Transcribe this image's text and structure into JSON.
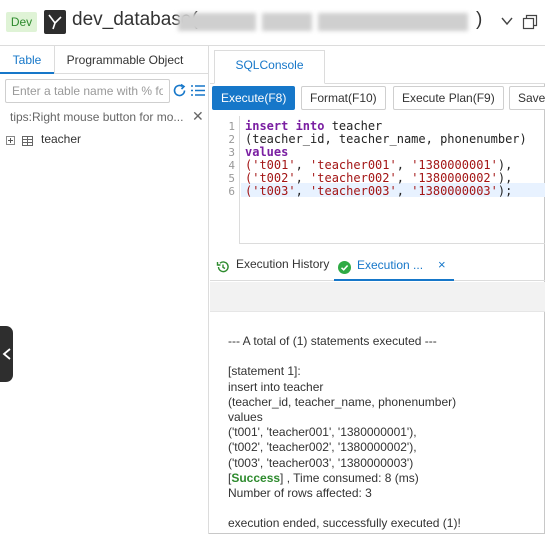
{
  "header": {
    "env_badge": "Dev",
    "db_name": "dev_database(",
    "db_name_close": ")"
  },
  "left": {
    "tabs": [
      "Table",
      "Programmable Object"
    ],
    "search_placeholder": "Enter a table name with % fo",
    "tips": "tips:Right mouse button for mo...",
    "tree": [
      {
        "label": "teacher"
      }
    ]
  },
  "console": {
    "tab_label": "SQLConsole",
    "toolbar": {
      "execute": "Execute(F8)",
      "format": "Format(F10)",
      "plan": "Execute Plan(F9)",
      "save": "Save"
    },
    "editor": {
      "line_numbers": [
        "1",
        "2",
        "3",
        "4",
        "5",
        "6"
      ],
      "lines": [
        {
          "kw": "insert into",
          "rest": " teacher"
        },
        {
          "kw": "",
          "rest": "(teacher_id, teacher_name, phonenumber)"
        },
        {
          "kw": "values",
          "rest": ""
        },
        {
          "a": "('t001'",
          "b": ", ",
          "c": "'teacher001'",
          "d": ", ",
          "e": "'1380000001'",
          "f": "),"
        },
        {
          "a": "('t002'",
          "b": ", ",
          "c": "'teacher002'",
          "d": ", ",
          "e": "'1380000002'",
          "f": "),"
        },
        {
          "a": "('t003'",
          "b": ", ",
          "c": "'teacher003'",
          "d": ", ",
          "e": "'1380000003'",
          "f": ");"
        }
      ]
    }
  },
  "results": {
    "history_tab": "Execution History",
    "exec_tab": "Execution ...",
    "close_glyph": "×",
    "summary": "--- A total of (1) statements executed ---",
    "statement_label": "[statement 1]:",
    "statement_lines": [
      "insert into teacher",
      "(teacher_id, teacher_name, phonenumber)",
      "values",
      "('t001', 'teacher001', '1380000001'),",
      "('t002', 'teacher002', '1380000002'),",
      "('t003', 'teacher003', '1380000003')"
    ],
    "success_open": "[",
    "success_word": "Success",
    "success_rest": "] , Time consumed: 8 (ms)",
    "rows_affected": "Number of rows affected: 3",
    "ended": "execution ended, successfully executed (1)!"
  },
  "colors": {
    "accent": "#1677c9",
    "success": "#2e8b2e",
    "keyword": "#7a1fa2",
    "string": "#a31515"
  }
}
